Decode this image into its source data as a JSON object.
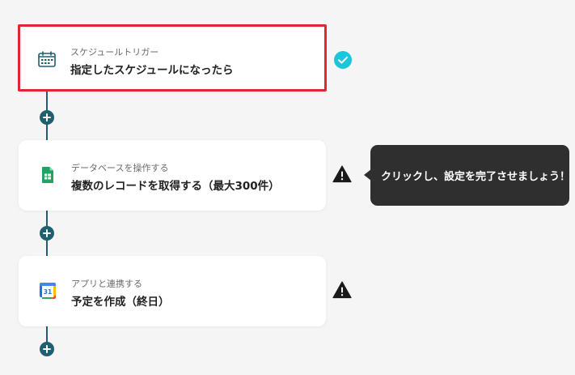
{
  "flow": {
    "steps": [
      {
        "subtitle": "スケジュールトリガー",
        "title": "指定したスケジュールになったら",
        "icon": "schedule-trigger-icon",
        "status": "complete",
        "selected": true
      },
      {
        "subtitle": "データベースを操作する",
        "title": "複数のレコードを取得する（最大300件）",
        "icon": "google-sheets-icon",
        "status": "warning",
        "selected": false
      },
      {
        "subtitle": "アプリと連携する",
        "title": "予定を作成（終日）",
        "icon": "google-calendar-icon",
        "status": "warning",
        "selected": false
      }
    ],
    "calendar_icon_day": "31"
  },
  "tooltip": {
    "text": "クリックし、設定を完了させましょう！"
  },
  "colors": {
    "flow_line": "#1f5f6e",
    "selected_border": "#e3262c",
    "complete_check": "#1cc6da",
    "warning": "#1a1a1a",
    "sheets_green": "#1fa463",
    "tooltip_bg": "#2f2f2f"
  }
}
